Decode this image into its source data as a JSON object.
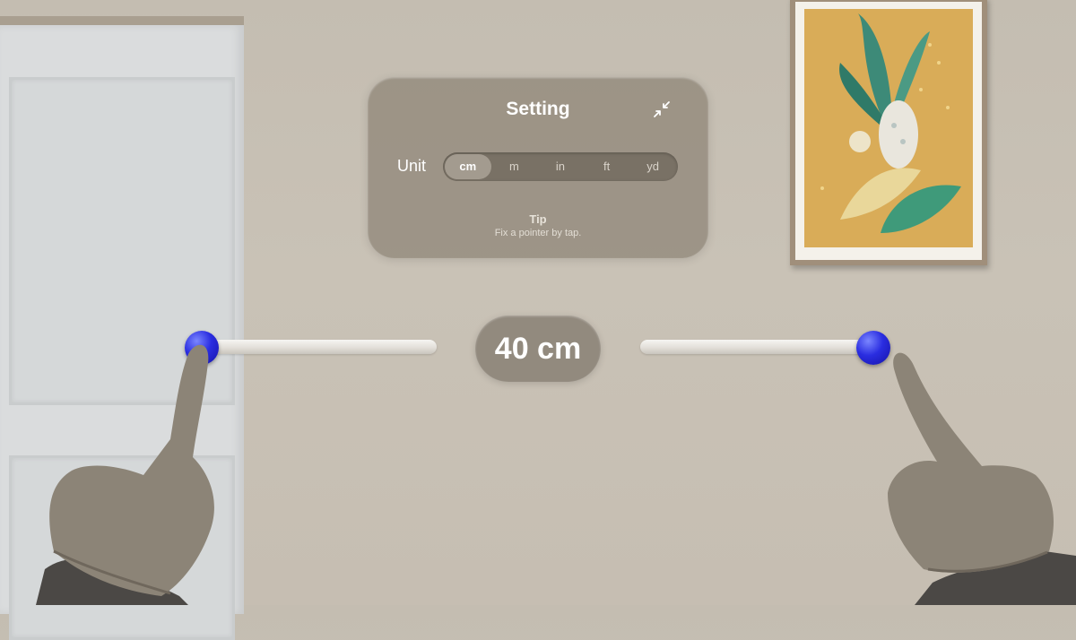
{
  "settings": {
    "title": "Setting",
    "collapse_icon": "collapse-arrows-icon",
    "unit_label": "Unit",
    "units": [
      "cm",
      "m",
      "in",
      "ft",
      "yd"
    ],
    "selected_unit": "cm",
    "tip_title": "Tip",
    "tip_text": "Fix a pointer by tap."
  },
  "measurement": {
    "value_label": "40 cm",
    "pointer_color": "#2a2de0"
  },
  "colors": {
    "panel": "#91887a",
    "accent_pointer": "#2a2de0"
  }
}
